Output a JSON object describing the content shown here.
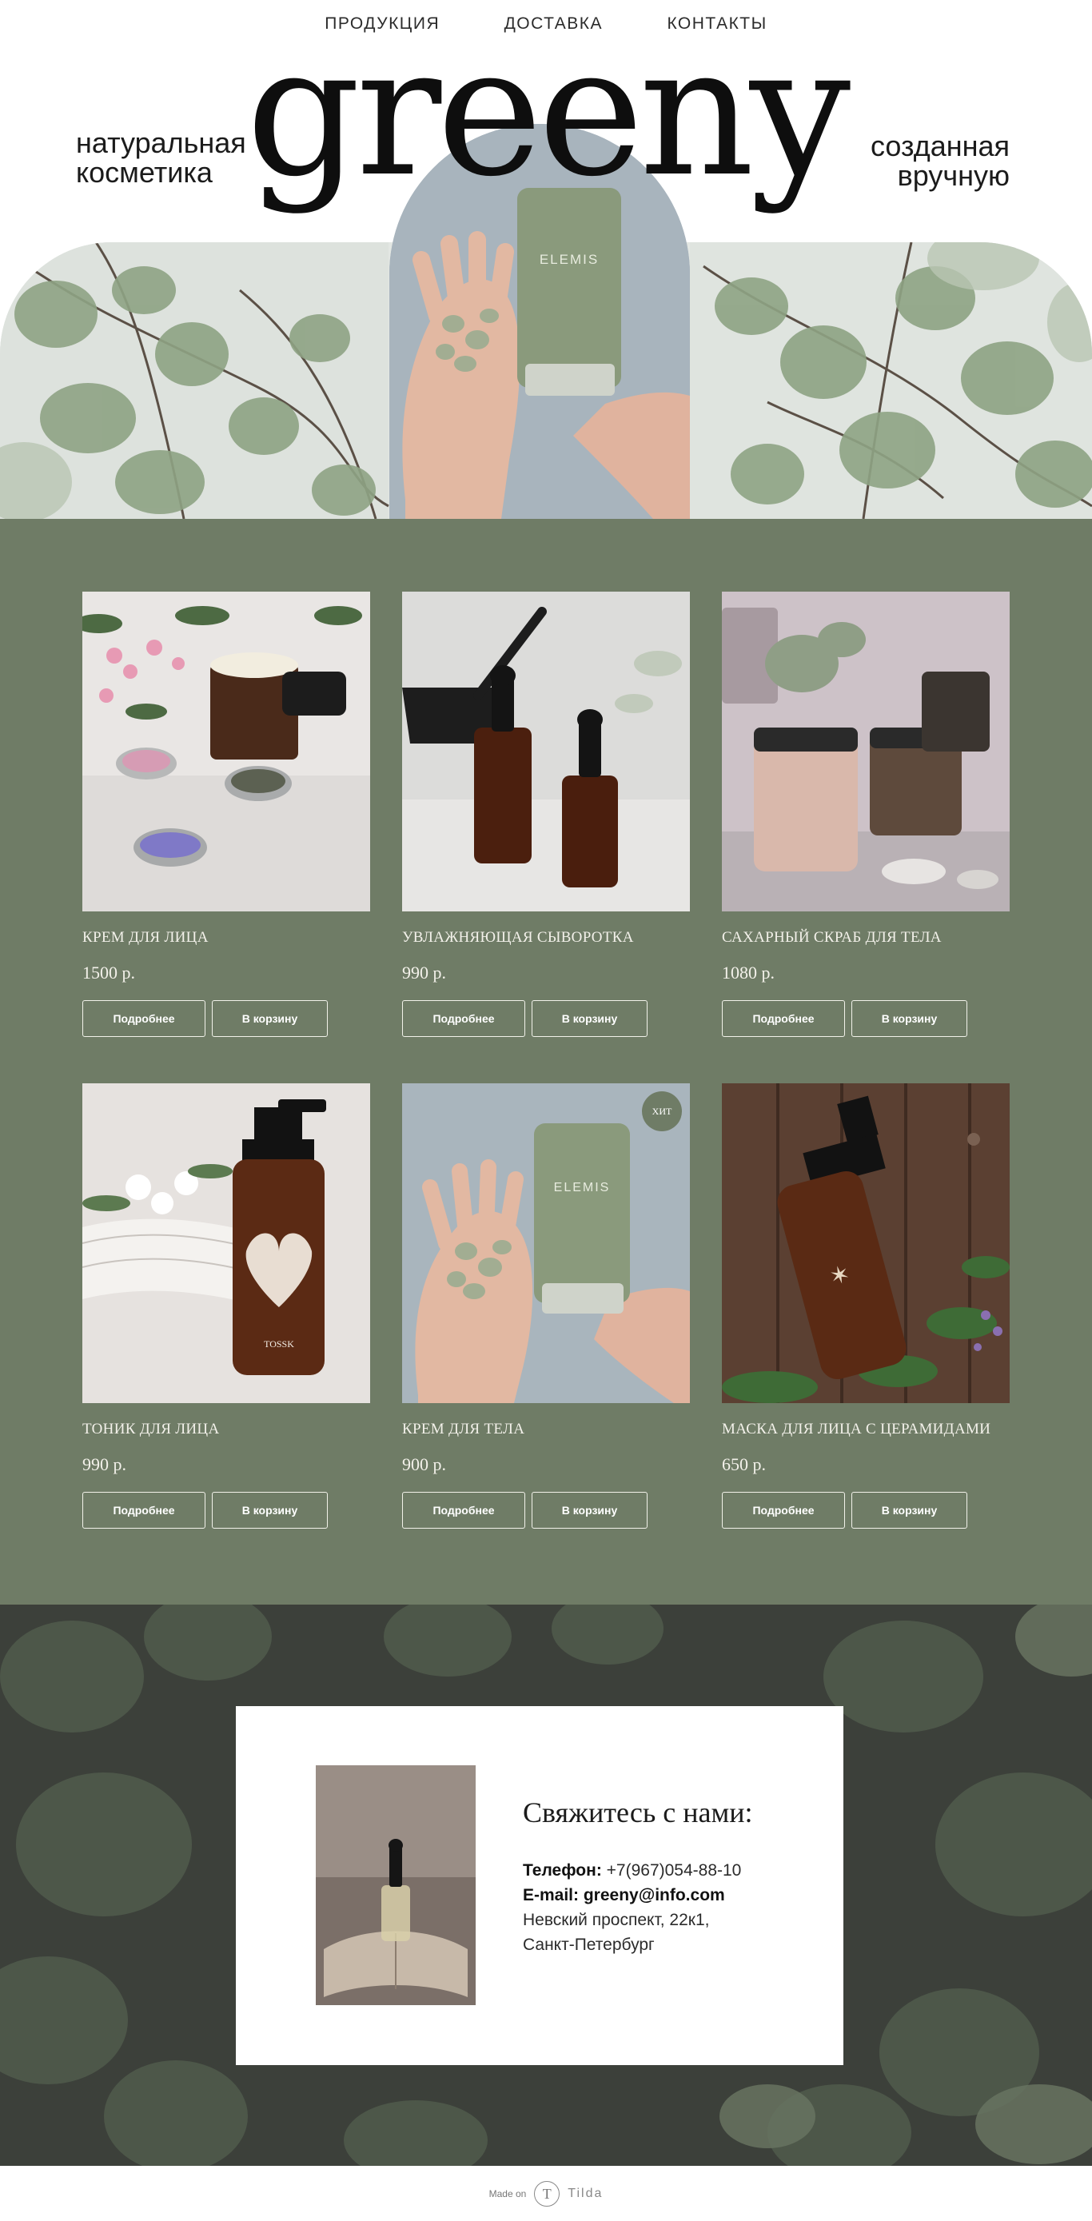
{
  "nav": {
    "items": [
      "ПРОДУКЦИЯ",
      "ДОСТАВКА",
      "КОНТАКТЫ"
    ]
  },
  "header": {
    "logo": "greeny",
    "tagline_left": [
      "натуральная",
      "косметика"
    ],
    "tagline_right": [
      "созданная",
      "вручную"
    ]
  },
  "products": [
    {
      "name": "КРЕМ ДЛЯ ЛИЦА",
      "price": "1500 р.",
      "more": "Подробнее",
      "cart": "В корзину"
    },
    {
      "name": "УВЛАЖНЯЮЩАЯ СЫВОРОТКА",
      "price": "990 р.",
      "more": "Подробнее",
      "cart": "В корзину"
    },
    {
      "name": "САХАРНЫЙ СКРАБ ДЛЯ ТЕЛА",
      "price": "1080 р.",
      "more": "Подробнее",
      "cart": "В корзину"
    },
    {
      "name": "ТОНИК ДЛЯ ЛИЦА",
      "price": "990 р.",
      "more": "Подробнее",
      "cart": "В корзину"
    },
    {
      "name": "КРЕМ ДЛЯ ТЕЛА",
      "price": "900 р.",
      "more": "Подробнее",
      "cart": "В корзину",
      "badge": "ХИТ"
    },
    {
      "name": "МАСКА ДЛЯ ЛИЦА С ЦЕРАМИДАМИ",
      "price": "650 р.",
      "more": "Подробнее",
      "cart": "В корзину"
    }
  ],
  "contact": {
    "title": "Свяжитесь с нами:",
    "phone_label": "Телефон:",
    "phone": "+7(967)054-88-10",
    "email_label": "E-mail:",
    "email": "greeny@info.com",
    "address1": "Невский проспект, 22к1,",
    "address2": "Санкт-Петербург"
  },
  "footer": {
    "made_on": "Made on",
    "platform": "Tilda",
    "logo_letter": "T"
  },
  "colors": {
    "products_bg": "#6f7c66",
    "contact_bg": "#3a3e38",
    "text_light": "#f3f1ea"
  }
}
